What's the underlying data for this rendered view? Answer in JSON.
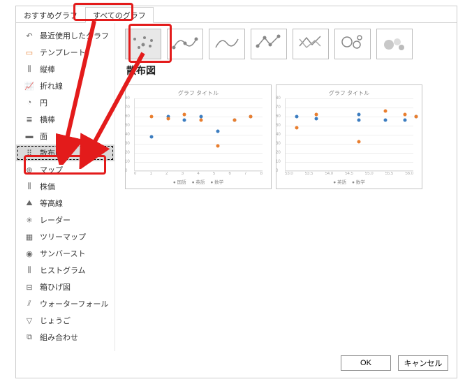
{
  "tabs": {
    "recommended": "おすすめグラフ",
    "all": "すべてのグラフ"
  },
  "sidebar": {
    "items": [
      {
        "label": "最近使用したグラフ"
      },
      {
        "label": "テンプレート"
      },
      {
        "label": "縦棒"
      },
      {
        "label": "折れ線"
      },
      {
        "label": "円"
      },
      {
        "label": "横棒"
      },
      {
        "label": "面"
      },
      {
        "label": "散布図"
      },
      {
        "label": "マップ"
      },
      {
        "label": "株価"
      },
      {
        "label": "等高線"
      },
      {
        "label": "レーダー"
      },
      {
        "label": "ツリーマップ"
      },
      {
        "label": "サンバースト"
      },
      {
        "label": "ヒストグラム"
      },
      {
        "label": "箱ひげ図"
      },
      {
        "label": "ウォーターフォール"
      },
      {
        "label": "じょうご"
      },
      {
        "label": "組み合わせ"
      }
    ]
  },
  "section_title": "散布図",
  "chart_data": [
    {
      "type": "scatter",
      "title": "グラフ タイトル",
      "ylim": [
        0,
        80
      ],
      "yticks": [
        0,
        10,
        20,
        30,
        40,
        50,
        60,
        70,
        80
      ],
      "xticks": [
        "0",
        "1",
        "2",
        "3",
        "4",
        "5",
        "6",
        "7",
        "8"
      ],
      "series": [
        {
          "name": "国語",
          "color": "#3c7dc0",
          "points": [
            {
              "x": 1,
              "y": 38
            },
            {
              "x": 2,
              "y": 60
            },
            {
              "x": 3,
              "y": 56
            },
            {
              "x": 4,
              "y": 60
            },
            {
              "x": 5,
              "y": 44
            },
            {
              "x": 6,
              "y": 56
            },
            {
              "x": 7,
              "y": 60
            }
          ]
        },
        {
          "name": "英語",
          "color": "#e97e2e",
          "points": [
            {
              "x": 1,
              "y": 60
            },
            {
              "x": 2,
              "y": 58
            },
            {
              "x": 3,
              "y": 62
            },
            {
              "x": 4,
              "y": 56
            },
            {
              "x": 5,
              "y": 28
            },
            {
              "x": 6,
              "y": 56
            },
            {
              "x": 7,
              "y": 60
            }
          ]
        },
        {
          "name": "数学",
          "color": "#888",
          "points": []
        }
      ],
      "legend": [
        "国語",
        "英語",
        "数学"
      ]
    },
    {
      "type": "scatter",
      "title": "グラフ タイトル",
      "ylim": [
        0,
        80
      ],
      "yticks": [
        0,
        10,
        20,
        30,
        40,
        50,
        60,
        70,
        80
      ],
      "xticks": [
        "53.0",
        "53.5",
        "54.0",
        "54.5",
        "55.0",
        "55.5",
        "56.0"
      ],
      "series": [
        {
          "name": "英語",
          "color": "#3c7dc0",
          "points": [
            {
              "x": 0.5,
              "y": 60
            },
            {
              "x": 1.4,
              "y": 58
            },
            {
              "x": 3.3,
              "y": 62
            },
            {
              "x": 3.3,
              "y": 56
            },
            {
              "x": 4.5,
              "y": 56
            },
            {
              "x": 5.4,
              "y": 56
            },
            {
              "x": 5.9,
              "y": 60
            }
          ]
        },
        {
          "name": "数学",
          "color": "#e97e2e",
          "points": [
            {
              "x": 0.5,
              "y": 48
            },
            {
              "x": 1.4,
              "y": 62
            },
            {
              "x": 3.3,
              "y": 32
            },
            {
              "x": 4.5,
              "y": 66
            },
            {
              "x": 5.4,
              "y": 62
            },
            {
              "x": 5.9,
              "y": 60
            }
          ]
        }
      ],
      "legend": [
        "英語",
        "数学"
      ]
    }
  ],
  "footer": {
    "ok": "OK",
    "cancel": "キャンセル"
  }
}
